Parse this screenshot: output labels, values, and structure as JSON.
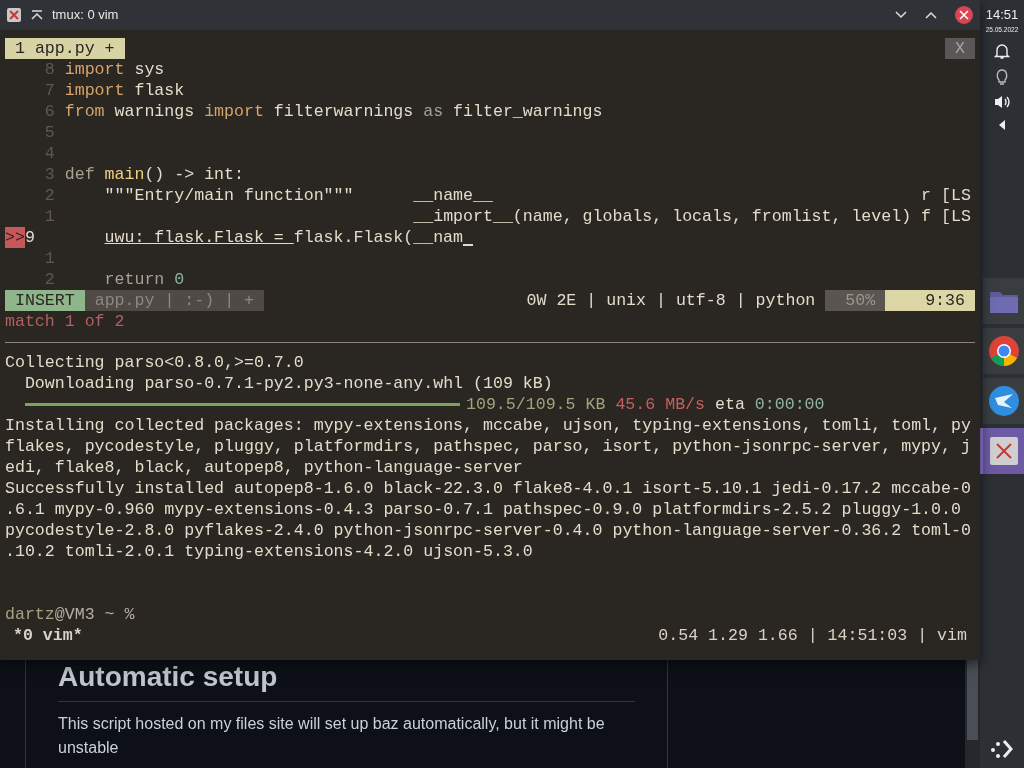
{
  "window": {
    "title": "tmux: 0 vim"
  },
  "vim": {
    "tabs": [
      {
        "label": "1 app.py +",
        "selected": true
      }
    ],
    "close_label": "X",
    "lines": [
      {
        "number": "8",
        "tokens": [
          {
            "kind": "keyword",
            "text": "import"
          },
          {
            "kind": "plain",
            "text": " sys"
          }
        ]
      },
      {
        "number": "7",
        "tokens": [
          {
            "kind": "keyword",
            "text": "import"
          },
          {
            "kind": "plain",
            "text": " flask"
          }
        ]
      },
      {
        "number": "6",
        "tokens": [
          {
            "kind": "keyword",
            "text": "from"
          },
          {
            "kind": "plain",
            "text": " warnings "
          },
          {
            "kind": "keyword",
            "text": "import"
          },
          {
            "kind": "plain",
            "text": " filterwarnings "
          },
          {
            "kind": "operator",
            "text": "as"
          },
          {
            "kind": "plain",
            "text": " filter_warnings"
          }
        ]
      },
      {
        "number": "5"
      },
      {
        "number": "4"
      },
      {
        "number": "3",
        "tokens": [
          {
            "kind": "operator",
            "text": "def"
          },
          {
            "kind": "function",
            "text": " main"
          },
          {
            "kind": "plain",
            "text": "() -> int:"
          }
        ]
      },
      {
        "number": "2",
        "tokens": [
          {
            "kind": "plain",
            "text": "    \"\"\"Entry/main function\"\"\""
          }
        ]
      },
      {
        "number": "1"
      },
      {
        "number": "9",
        "current": true,
        "sign": ">>",
        "indented": true,
        "tokens": [
          {
            "kind": "underlined",
            "text": "uwu: flask.Flask = "
          },
          {
            "kind": "plain",
            "text": "flask.Flask(__nam"
          }
        ]
      },
      {
        "number": "1"
      },
      {
        "number": "2",
        "indented": true,
        "tokens": [
          {
            "kind": "operator",
            "text": "return"
          },
          {
            "kind": "number",
            "text": " 0"
          }
        ]
      }
    ],
    "completion": [
      {
        "word": "__name__",
        "type": "r",
        "menu": "[LS"
      },
      {
        "word": "__import__(name, globals, locals, fromlist, level)",
        "type": "f",
        "menu": "[LS"
      }
    ],
    "status": {
      "mode": "INSERT",
      "file": "app.py | :-) | +",
      "info": "0W 2E | unix | utf-8 | python",
      "percent": "50%",
      "position": "9:36"
    },
    "message": "match 1 of 2"
  },
  "shell": {
    "lines": [
      {
        "kind": "text",
        "text": "Collecting parso<0.8.0,>=0.7.0"
      },
      {
        "kind": "text",
        "text": "  Downloading parso-0.7.1-py2.py3-none-any.whl (109 kB)"
      },
      {
        "kind": "progress",
        "level": 1,
        "size": "109.5/109.5 KB",
        "speed": "45.6 MB/s",
        "eta_label": "eta",
        "eta": "0:00:00"
      },
      {
        "kind": "text",
        "text": "Installing collected packages: mypy-extensions, mccabe, ujson, typing-extensions, tomli, toml, py"
      },
      {
        "kind": "text",
        "text": "flakes, pycodestyle, pluggy, platformdirs, pathspec, parso, isort, python-jsonrpc-server, mypy, j"
      },
      {
        "kind": "text",
        "text": "edi, flake8, black, autopep8, python-language-server"
      },
      {
        "kind": "text",
        "text": "Successfully installed autopep8-1.6.0 black-22.3.0 flake8-4.0.1 isort-5.10.1 jedi-0.17.2 mccabe-0"
      },
      {
        "kind": "text",
        "text": ".6.1 mypy-0.960 mypy-extensions-0.4.3 parso-0.7.1 pathspec-0.9.0 platformdirs-2.5.2 pluggy-1.0.0"
      },
      {
        "kind": "text",
        "text": "pycodestyle-2.8.0 pyflakes-2.4.0 python-jsonrpc-server-0.4.0 python-language-server-0.36.2 toml-0"
      },
      {
        "kind": "text",
        "text": ".10.2 tomli-2.0.1 typing-extensions-4.2.0 ujson-5.3.0"
      },
      {
        "kind": "blank"
      },
      {
        "kind": "blank"
      },
      {
        "kind": "prompt",
        "user": "dartz",
        "host": "@VM3 ~ %"
      }
    ]
  },
  "tmux": {
    "window": "*0 vim*",
    "right": "0.54 1.29 1.66 | 14:51:03 | vim"
  },
  "webpage": {
    "heading": "Automatic setup",
    "paragraph": "This script hosted on my files site will set up baz automatically, but it might be unstable"
  },
  "taskbar": {
    "time": "14:51",
    "date": "25.05.2022",
    "tasks": [
      {
        "selected": false
      },
      {
        "selected": false
      },
      {
        "selected": false
      },
      {
        "selected": true
      }
    ]
  }
}
